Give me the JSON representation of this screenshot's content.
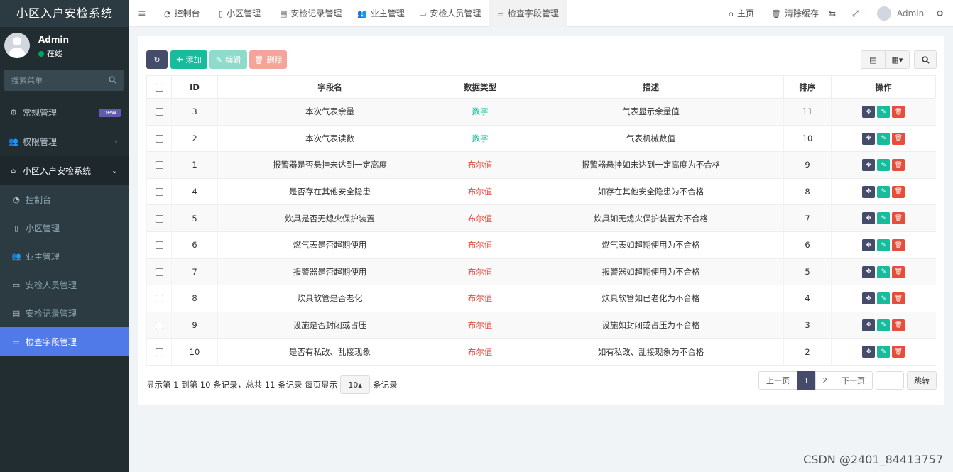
{
  "app": {
    "title": "小区入户安检系统"
  },
  "user": {
    "name": "Admin",
    "status": "在线"
  },
  "sidebar": {
    "search_placeholder": "搜索菜单",
    "items": [
      {
        "label": "常规管理",
        "icon": "cogs-icon",
        "badge": "new"
      },
      {
        "label": "权限管理",
        "icon": "users-icon",
        "arrow": "‹"
      },
      {
        "label": "小区入户安检系统",
        "icon": "home-shield-icon",
        "arrow": "⌄"
      }
    ],
    "sub_items": [
      {
        "label": "控制台",
        "icon": "dashboard-icon"
      },
      {
        "label": "小区管理",
        "icon": "building-icon"
      },
      {
        "label": "业主管理",
        "icon": "users-icon"
      },
      {
        "label": "安检人员管理",
        "icon": "id-card-icon"
      },
      {
        "label": "安检记录管理",
        "icon": "file-icon"
      },
      {
        "label": "检查字段管理",
        "icon": "list-icon",
        "active": true
      }
    ]
  },
  "topbar": {
    "tabs": [
      "控制台",
      "小区管理",
      "安检记录管理",
      "业主管理",
      "安检人员管理",
      "检查字段管理"
    ],
    "home": "主页",
    "clear_cache": "清除缓存",
    "user": "Admin"
  },
  "toolbar": {
    "add": "添加",
    "edit": "编辑",
    "delete": "删除"
  },
  "table": {
    "headers": [
      "ID",
      "字段名",
      "数据类型",
      "描述",
      "排序",
      "操作"
    ],
    "rows": [
      {
        "id": "3",
        "name": "本次气表余量",
        "type": "数字",
        "desc": "气表显示余量值",
        "sort": "11"
      },
      {
        "id": "2",
        "name": "本次气表读数",
        "type": "数字",
        "desc": "气表机械数值",
        "sort": "10"
      },
      {
        "id": "1",
        "name": "报警器是否悬挂未达到一定高度",
        "type": "布尔值",
        "desc": "报警器悬挂如未达到一定高度为不合格",
        "sort": "9"
      },
      {
        "id": "4",
        "name": "是否存在其他安全隐患",
        "type": "布尔值",
        "desc": "如存在其他安全隐患为不合格",
        "sort": "8"
      },
      {
        "id": "5",
        "name": "炊具是否无熄火保护装置",
        "type": "布尔值",
        "desc": "炊具如无熄火保护装置为不合格",
        "sort": "7"
      },
      {
        "id": "6",
        "name": "燃气表是否超期使用",
        "type": "布尔值",
        "desc": "燃气表如超期使用为不合格",
        "sort": "6"
      },
      {
        "id": "7",
        "name": "报警器是否超期使用",
        "type": "布尔值",
        "desc": "报警器如超期使用为不合格",
        "sort": "5"
      },
      {
        "id": "8",
        "name": "炊具软管是否老化",
        "type": "布尔值",
        "desc": "炊具软管如已老化为不合格",
        "sort": "4"
      },
      {
        "id": "9",
        "name": "设施是否封闭或占压",
        "type": "布尔值",
        "desc": "设施如封闭或占压为不合格",
        "sort": "3"
      },
      {
        "id": "10",
        "name": "是否有私改、乱接现象",
        "type": "布尔值",
        "desc": "如有私改、乱接现象为不合格",
        "sort": "2"
      }
    ]
  },
  "footer": {
    "info": "显示第 1 到第 10 条记录，总共 11 条记录 每页显示",
    "page_size": "10",
    "suffix": "条记录",
    "prev": "上一页",
    "pages": [
      "1",
      "2"
    ],
    "next": "下一页",
    "jump": "跳转"
  },
  "watermark": "CSDN @2401_84413757"
}
